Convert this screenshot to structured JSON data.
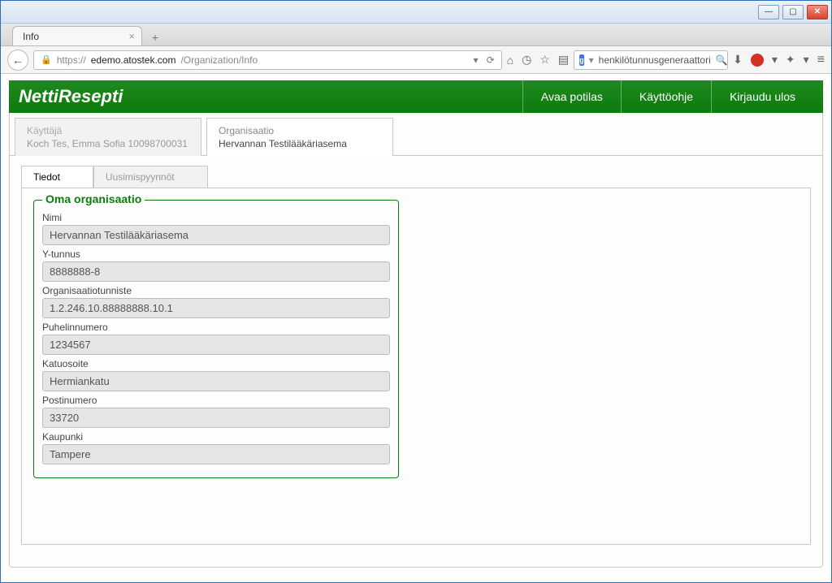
{
  "browser": {
    "tab_title": "Info",
    "url_host": "edemo.atostek.com",
    "url_path": "/Organization/Info",
    "search_placeholder": "henkilötunnusgeneraattori"
  },
  "header": {
    "title": "NettiResepti",
    "nav": {
      "open_patient": "Avaa potilas",
      "guide": "Käyttöohje",
      "logout": "Kirjaudu ulos"
    }
  },
  "context": {
    "user_label": "Käyttäjä",
    "user_value": "Koch Tes, Emma Sofia 10098700031",
    "org_label": "Organisaatio",
    "org_value": "Hervannan Testilääkäriasema"
  },
  "subtabs": {
    "info": "Tiedot",
    "renewals": "Uusimispyynnöt"
  },
  "fieldset": {
    "legend": "Oma organisaatio",
    "fields": {
      "name_label": "Nimi",
      "name_value": "Hervannan Testilääkäriasema",
      "ytunnus_label": "Y-tunnus",
      "ytunnus_value": "8888888-8",
      "orgid_label": "Organisaatiotunniste",
      "orgid_value": "1.2.246.10.88888888.10.1",
      "phone_label": "Puhelinnumero",
      "phone_value": "1234567",
      "street_label": "Katuosoite",
      "street_value": "Hermiankatu",
      "postal_label": "Postinumero",
      "postal_value": "33720",
      "city_label": "Kaupunki",
      "city_value": "Tampere"
    }
  }
}
